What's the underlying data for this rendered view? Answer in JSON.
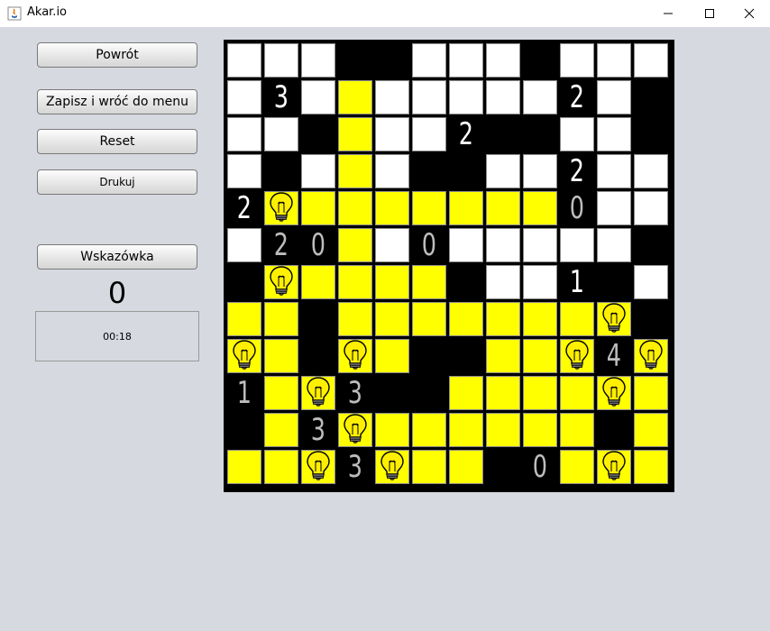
{
  "window": {
    "title": "Akar.io",
    "icon": "java-icon",
    "controls": [
      "minimize-icon",
      "maximize-icon",
      "close-icon"
    ]
  },
  "sidebar": {
    "back_label": "Powrót",
    "save_label": "Zapisz i wróć do menu",
    "reset_label": "Reset",
    "print_label": "Drukuj",
    "hint_label": "Wskazówka",
    "hint_count": "0",
    "timer": "00:18"
  },
  "colors": {
    "background": "#d6d9e0",
    "wall": "#000000",
    "empty": "#ffffff",
    "lit": "#ffff00",
    "satisfied_number": "#bdbdbd",
    "unsatisfied_number": "#ffffff"
  },
  "board": {
    "size": 12,
    "legend": "W=empty, Y=lit, B=black wall, L=bulb, digit=numbered wall (s=satisfied/grey, u=unsatisfied/white)",
    "rows": [
      [
        "W",
        "W",
        "W",
        "B",
        "B",
        "W",
        "W",
        "W",
        "B",
        "W",
        "W",
        "W"
      ],
      [
        "W",
        "3u",
        "W",
        "Y",
        "W",
        "W",
        "W",
        "W",
        "W",
        "2u",
        "W",
        "B"
      ],
      [
        "W",
        "W",
        "B",
        "Y",
        "W",
        "W",
        "2u",
        "B",
        "B",
        "W",
        "W",
        "B"
      ],
      [
        "W",
        "B",
        "W",
        "Y",
        "W",
        "B",
        "B",
        "W",
        "W",
        "2u",
        "W",
        "W"
      ],
      [
        "2u",
        "L",
        "Y",
        "Y",
        "Y",
        "Y",
        "Y",
        "Y",
        "Y",
        "0s",
        "W",
        "W"
      ],
      [
        "W",
        "2s",
        "0s",
        "Y",
        "W",
        "0s",
        "W",
        "W",
        "W",
        "W",
        "W",
        "B"
      ],
      [
        "B",
        "L",
        "Y",
        "Y",
        "Y",
        "Y",
        "B",
        "W",
        "W",
        "1u",
        "B",
        "W"
      ],
      [
        "Y",
        "Y",
        "B",
        "Y",
        "Y",
        "Y",
        "Y",
        "Y",
        "Y",
        "Y",
        "L",
        "B"
      ],
      [
        "L",
        "Y",
        "B",
        "L",
        "Y",
        "B",
        "B",
        "Y",
        "Y",
        "L",
        "4s",
        "L"
      ],
      [
        "1s",
        "Y",
        "L",
        "3s",
        "B",
        "B",
        "Y",
        "Y",
        "Y",
        "Y",
        "L",
        "Y"
      ],
      [
        "B",
        "Y",
        "3s",
        "L",
        "Y",
        "Y",
        "Y",
        "Y",
        "Y",
        "Y",
        "B",
        "Y"
      ],
      [
        "Y",
        "Y",
        "L",
        "3s",
        "L",
        "Y",
        "Y",
        "B",
        "0s",
        "Y",
        "L",
        "Y"
      ]
    ]
  }
}
